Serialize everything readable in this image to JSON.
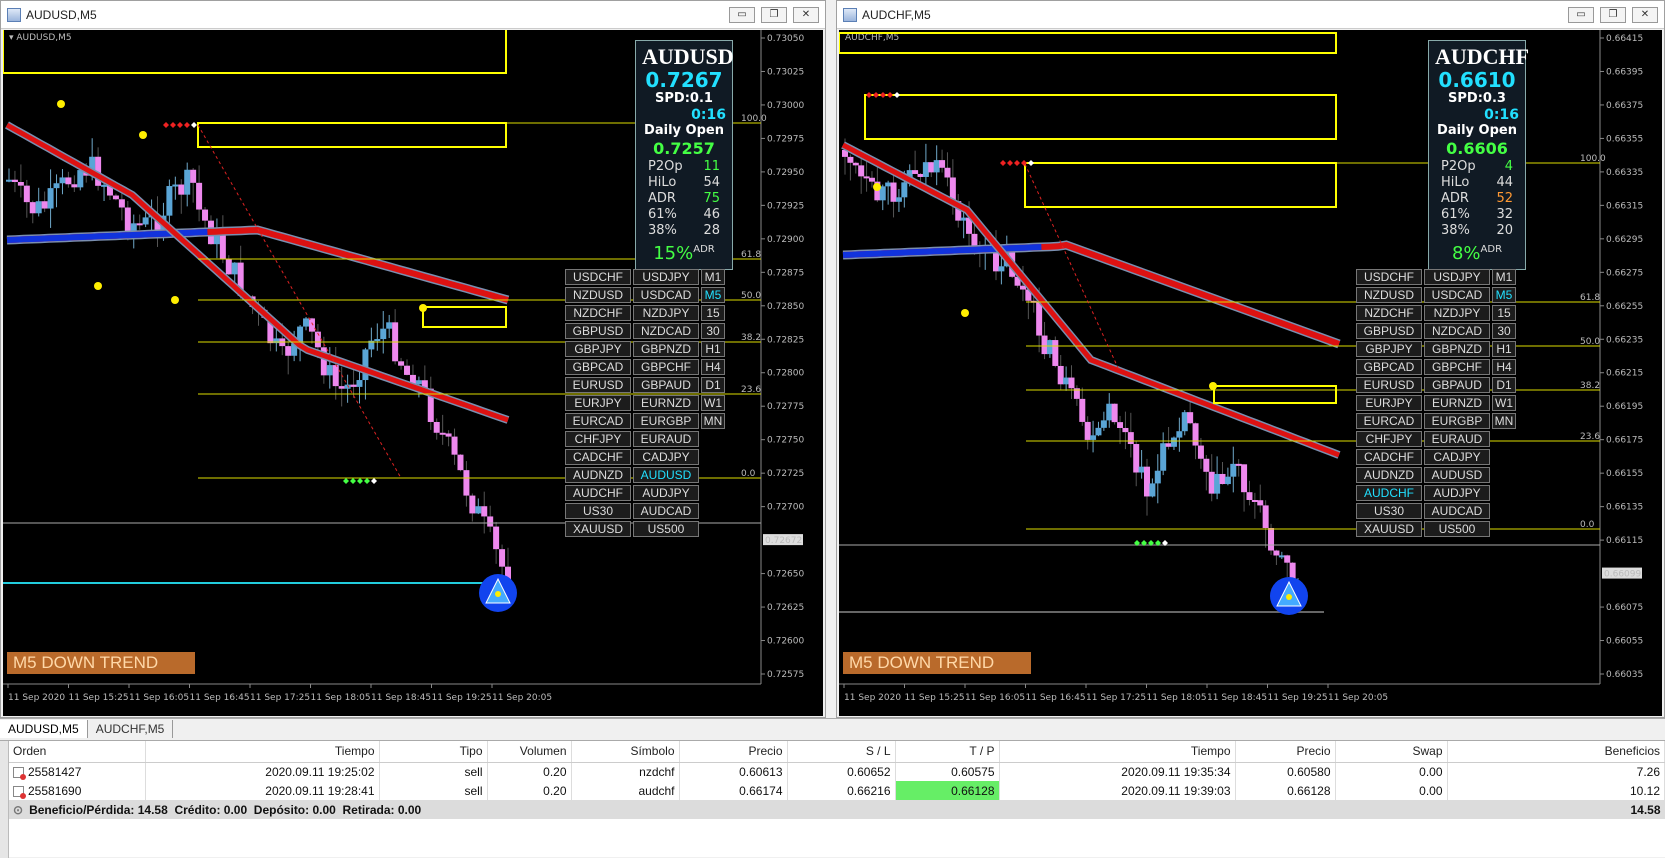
{
  "left": {
    "title": "AUDUSD,M5",
    "chart_label": "AUDUSD,M5",
    "panel": {
      "symbol": "AUDUSD",
      "price": "0.7267",
      "spd": "SPD:0.1",
      "time": "0:16",
      "daily_open_label": "Daily Open",
      "daily_open": "0.7257",
      "rows": [
        {
          "label": "P2Op",
          "value": "11",
          "color": "#44ff44"
        },
        {
          "label": "HiLo",
          "value": "54",
          "color": "#dddddd"
        },
        {
          "label": "ADR",
          "value": "75",
          "color": "#44ff44"
        },
        {
          "label": "61%",
          "value": "46",
          "color": "#dddddd"
        },
        {
          "label": "38%",
          "value": "28",
          "color": "#dddddd"
        }
      ],
      "pct": "15%",
      "pct_suffix": "ADR"
    },
    "symbols": [
      [
        "USDCHF",
        "USDJPY",
        "M1"
      ],
      [
        "NZDUSD",
        "USDCAD",
        "M5"
      ],
      [
        "NZDCHF",
        "NZDJPY",
        "15"
      ],
      [
        "GBPUSD",
        "NZDCAD",
        "30"
      ],
      [
        "GBPJPY",
        "GBPNZD",
        "H1"
      ],
      [
        "GBPCAD",
        "GBPCHF",
        "H4"
      ],
      [
        "EURUSD",
        "GBPAUD",
        "D1"
      ],
      [
        "EURJPY",
        "EURNZD",
        "W1"
      ],
      [
        "EURCAD",
        "EURGBP",
        "MN"
      ],
      [
        "CHFJPY",
        "EURAUD",
        ""
      ],
      [
        "CADCHF",
        "CADJPY",
        ""
      ],
      [
        "AUDNZD",
        "AUDUSD",
        ""
      ],
      [
        "AUDCHF",
        "AUDJPY",
        ""
      ],
      [
        "US30",
        "AUDCAD",
        ""
      ],
      [
        "XAUUSD",
        "US500",
        ""
      ]
    ],
    "active_symbol": "AUDUSD",
    "active_tf": "M5",
    "trend": "M5 DOWN TREND",
    "price_axis": [
      "0.73050",
      "0.73025",
      "0.73000",
      "0.72975",
      "0.72950",
      "0.72925",
      "0.72900",
      "0.72875",
      "0.72850",
      "0.72825",
      "0.72800",
      "0.72775",
      "0.72750",
      "0.72725",
      "0.72700",
      "0.72672",
      "0.72650",
      "0.72625",
      "0.72600",
      "0.72575"
    ],
    "time_axis": [
      "11 Sep 2020",
      "11 Sep 15:25",
      "11 Sep 16:05",
      "11 Sep 16:45",
      "11 Sep 17:25",
      "11 Sep 18:05",
      "11 Sep 18:45",
      "11 Sep 19:25",
      "11 Sep 20:05"
    ],
    "current_price": "0.72672",
    "fib": [
      "100.0",
      "61.8",
      "50.0",
      "38.2",
      "23.6",
      "0.0"
    ]
  },
  "right": {
    "title": "AUDCHF,M5",
    "chart_label": "AUDCHF,M5",
    "panel": {
      "symbol": "AUDCHF",
      "price": "0.6610",
      "spd": "SPD:0.3",
      "time": "0:16",
      "daily_open_label": "Daily Open",
      "daily_open": "0.6606",
      "rows": [
        {
          "label": "P2Op",
          "value": "4",
          "color": "#44ff44"
        },
        {
          "label": "HiLo",
          "value": "44",
          "color": "#dddddd"
        },
        {
          "label": "ADR",
          "value": "52",
          "color": "#ff9933"
        },
        {
          "label": "61%",
          "value": "32",
          "color": "#dddddd"
        },
        {
          "label": "38%",
          "value": "20",
          "color": "#dddddd"
        }
      ],
      "pct": "8%",
      "pct_suffix": "ADR"
    },
    "symbols": [
      [
        "USDCHF",
        "USDJPY",
        "M1"
      ],
      [
        "NZDUSD",
        "USDCAD",
        "M5"
      ],
      [
        "NZDCHF",
        "NZDJPY",
        "15"
      ],
      [
        "GBPUSD",
        "NZDCAD",
        "30"
      ],
      [
        "GBPJPY",
        "GBPNZD",
        "H1"
      ],
      [
        "GBPCAD",
        "GBPCHF",
        "H4"
      ],
      [
        "EURUSD",
        "GBPAUD",
        "D1"
      ],
      [
        "EURJPY",
        "EURNZD",
        "W1"
      ],
      [
        "EURCAD",
        "EURGBP",
        "MN"
      ],
      [
        "CHFJPY",
        "EURAUD",
        ""
      ],
      [
        "CADCHF",
        "CADJPY",
        ""
      ],
      [
        "AUDNZD",
        "AUDUSD",
        ""
      ],
      [
        "AUDCHF",
        "AUDJPY",
        ""
      ],
      [
        "US30",
        "AUDCAD",
        ""
      ],
      [
        "XAUUSD",
        "US500",
        ""
      ]
    ],
    "active_symbol": "AUDCHF",
    "active_tf": "M5",
    "trend": "M5 DOWN TREND",
    "price_axis": [
      "0.66415",
      "0.66395",
      "0.66375",
      "0.66355",
      "0.66335",
      "0.66315",
      "0.66295",
      "0.66275",
      "0.66255",
      "0.66235",
      "0.66215",
      "0.66195",
      "0.66175",
      "0.66155",
      "0.66135",
      "0.66115",
      "0.66099",
      "0.66075",
      "0.66055",
      "0.66035"
    ],
    "time_axis": [
      "11 Sep 2020",
      "11 Sep 15:25",
      "11 Sep 16:05",
      "11 Sep 16:45",
      "11 Sep 17:25",
      "11 Sep 18:05",
      "11 Sep 18:45",
      "11 Sep 19:25",
      "11 Sep 20:05"
    ],
    "current_price": "0.66099",
    "fib": [
      "100.0",
      "61.8",
      "50.0",
      "38.2",
      "23.6",
      "0.0"
    ]
  },
  "tabs": [
    "AUDUSD,M5",
    "AUDCHF,M5"
  ],
  "terminal": {
    "columns": [
      "Orden",
      "Tiempo",
      "Tipo",
      "Volumen",
      "Símbolo",
      "Precio",
      "S / L",
      "T / P",
      "Tiempo",
      "Precio",
      "Swap",
      "Beneficios"
    ],
    "rows": [
      [
        "25581427",
        "2020.09.11 19:25:02",
        "sell",
        "0.20",
        "nzdchf",
        "0.60613",
        "0.60652",
        "0.60575",
        "2020.09.11 19:35:34",
        "0.60580",
        "0.00",
        "7.26"
      ],
      [
        "25581690",
        "2020.09.11 19:28:41",
        "sell",
        "0.20",
        "audchf",
        "0.66174",
        "0.66216",
        "0.66128",
        "2020.09.11 19:39:03",
        "0.66128",
        "0.00",
        "10.12"
      ]
    ],
    "summary": "Beneficio/Pérdida: 14.58  Crédito: 0.00  Depósito: 0.00  Retirada: 0.00",
    "total": "14.58"
  },
  "colors": {
    "bull": "#5aa5d6",
    "bear": "#ee88ee",
    "ma_fast": "#dd1111",
    "ma_slow": "#1133dd",
    "box": "#ffff00",
    "panel_accent": "#22e0ff"
  }
}
